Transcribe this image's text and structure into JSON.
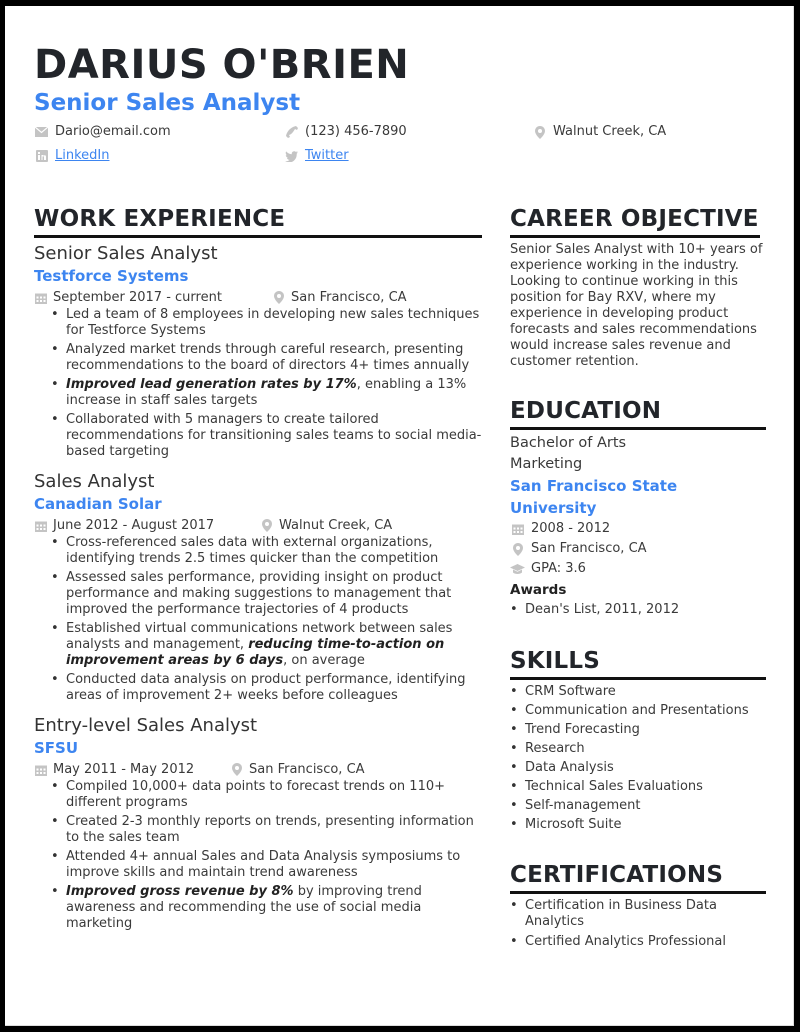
{
  "header": {
    "name": "DARIUS O'BRIEN",
    "title": "Senior Sales Analyst",
    "contacts": {
      "email": {
        "icon": "envelope-icon",
        "text": "Dario@email.com"
      },
      "phone": {
        "icon": "phone-icon",
        "text": "(123) 456-7890"
      },
      "location": {
        "icon": "map-pin-icon",
        "text": "Walnut Creek, CA"
      },
      "linkedin": {
        "icon": "linkedin-icon",
        "text": "LinkedIn"
      },
      "twitter": {
        "icon": "twitter-icon",
        "text": "Twitter"
      }
    }
  },
  "colors": {
    "accent": "#3d85f0",
    "heading": "#22252a",
    "body": "#3a3a3a",
    "icon": "#c4c4c4",
    "frame": "#000000"
  },
  "work": {
    "heading": "WORK EXPERIENCE",
    "jobs": [
      {
        "role": "Senior Sales Analyst",
        "company": "Testforce Systems",
        "dates": "September 2017 - current",
        "location": "San Francisco, CA",
        "bullets": [
          {
            "bold": "",
            "text": "Led a team of 8 employees in developing new sales techniques for Testforce Systems"
          },
          {
            "bold": "",
            "text": "Analyzed market trends through careful research, presenting recommendations to the board of directors 4+ times annually"
          },
          {
            "bold": "Improved lead generation rates by 17%",
            "text": ", enabling a 13% increase in staff sales targets"
          },
          {
            "bold": "",
            "text": "Collaborated with 5 managers to create tailored recommendations for transitioning sales teams to social media-based targeting"
          }
        ]
      },
      {
        "role": "Sales Analyst",
        "company": "Canadian Solar",
        "dates": "June 2012 - August 2017",
        "location": "Walnut Creek, CA",
        "bullets": [
          {
            "bold": "",
            "text": "Cross-referenced sales data with external organizations, identifying trends 2.5 times quicker than the competition"
          },
          {
            "bold": "",
            "text": "Assessed sales performance, providing insight on product performance and making suggestions to management that improved the performance trajectories of 4 products"
          },
          {
            "pre": "Established virtual communications network between sales analysts and management, ",
            "bold": "reducing time-to-action on improvement areas by 6 days",
            "text": ", on average"
          },
          {
            "bold": "",
            "text": "Conducted data analysis on product performance, identifying areas of improvement 2+ weeks before colleagues"
          }
        ]
      },
      {
        "role": "Entry-level Sales Analyst",
        "company": "SFSU",
        "dates": "May 2011 - May 2012",
        "location": "San Francisco, CA",
        "bullets": [
          {
            "bold": "",
            "text": "Compiled 10,000+ data points to forecast trends on 110+ different programs"
          },
          {
            "bold": "",
            "text": "Created 2-3 monthly reports on trends, presenting information to the sales team"
          },
          {
            "bold": "",
            "text": "Attended 4+ annual Sales and Data Analysis symposiums to improve skills and maintain trend awareness"
          },
          {
            "bold": "Improved gross revenue by 8%",
            "text": " by improving trend awareness and recommending the use of social media marketing"
          }
        ]
      }
    ]
  },
  "objective": {
    "heading": "CAREER OBJECTIVE",
    "text": "Senior Sales Analyst with 10+ years of experience working in the industry. Looking to continue working in this position for Bay RXV, where my experience in developing product forecasts and sales recommendations would increase sales revenue and customer retention."
  },
  "education": {
    "heading": "EDUCATION",
    "degree": "Bachelor of Arts",
    "major": "Marketing",
    "school": "San Francisco State University",
    "dates": "2008 - 2012",
    "location": "San Francisco, CA",
    "gpa": "GPA: 3.6",
    "awards_label": "Awards",
    "awards": [
      "Dean's List, 2011, 2012"
    ]
  },
  "skills": {
    "heading": "SKILLS",
    "items": [
      "CRM Software",
      "Communication and Presentations",
      "Trend Forecasting",
      "Research",
      "Data Analysis",
      "Technical Sales Evaluations",
      "Self-management",
      "Microsoft Suite"
    ]
  },
  "certifications": {
    "heading": "CERTIFICATIONS",
    "items": [
      "Certification in Business Data Analytics",
      "Certified Analytics Professional"
    ]
  }
}
